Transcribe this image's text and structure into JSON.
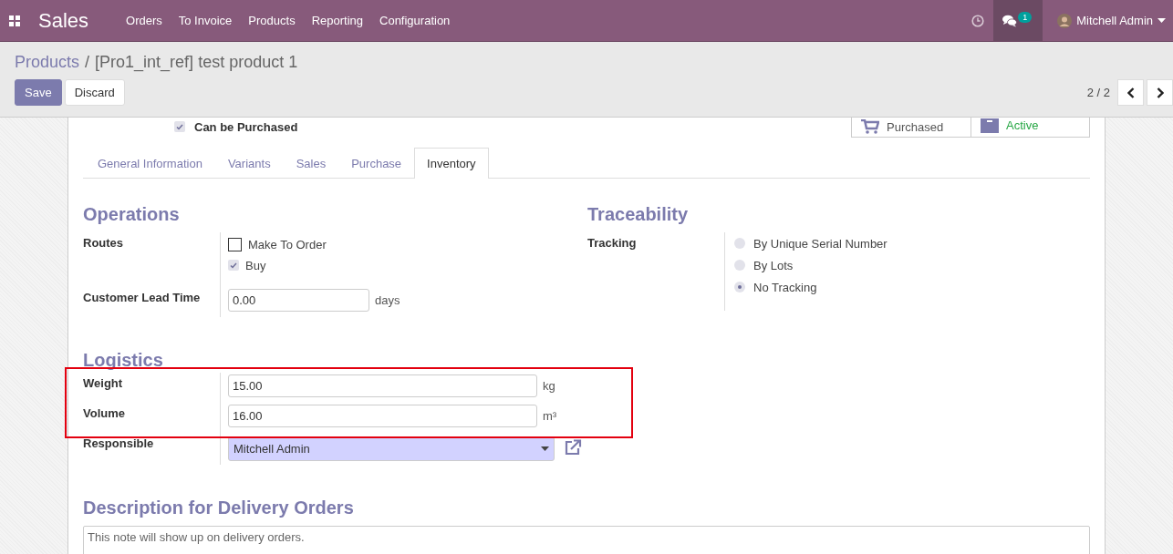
{
  "navbar": {
    "app": "Sales",
    "menu": [
      "Orders",
      "To Invoice",
      "Products",
      "Reporting",
      "Configuration"
    ],
    "chat_count": "1",
    "user": "Mitchell Admin"
  },
  "breadcrumb": {
    "parent": "Products",
    "separator": "/",
    "current": "[Pro1_int_ref] test product 1"
  },
  "actions": {
    "save": "Save",
    "discard": "Discard"
  },
  "pager": "2 / 2",
  "can_be_purchased": {
    "label": "Can be Purchased",
    "checked": true
  },
  "stat_buttons": [
    {
      "kind": "cart",
      "label": "Purchased"
    },
    {
      "kind": "archive",
      "label": "Active"
    }
  ],
  "tabs": [
    {
      "label": "General Information",
      "selected": false
    },
    {
      "label": "Variants",
      "selected": false
    },
    {
      "label": "Sales",
      "selected": false
    },
    {
      "label": "Purchase",
      "selected": false
    },
    {
      "label": "Inventory",
      "selected": true
    }
  ],
  "operations": {
    "title": "Operations",
    "routes_label": "Routes",
    "routes": [
      {
        "label": "Make To Order",
        "checked": false,
        "disabled": false
      },
      {
        "label": "Buy",
        "checked": true,
        "disabled": true
      }
    ],
    "lead_time": {
      "label": "Customer Lead Time",
      "value": "0.00",
      "unit": "days"
    }
  },
  "traceability": {
    "title": "Traceability",
    "label": "Tracking",
    "options": [
      {
        "label": "By Unique Serial Number",
        "selected": false
      },
      {
        "label": "By Lots",
        "selected": false
      },
      {
        "label": "No Tracking",
        "selected": true
      }
    ]
  },
  "logistics": {
    "title": "Logistics",
    "fields": [
      {
        "label": "Weight",
        "value": "15.00",
        "unit": "kg"
      },
      {
        "label": "Volume",
        "value": "16.00",
        "unit": "m³"
      }
    ],
    "responsible": {
      "label": "Responsible",
      "value": "Mitchell Admin"
    }
  },
  "description": {
    "title": "Description for Delivery Orders",
    "placeholder": "This note will show up on delivery orders."
  }
}
